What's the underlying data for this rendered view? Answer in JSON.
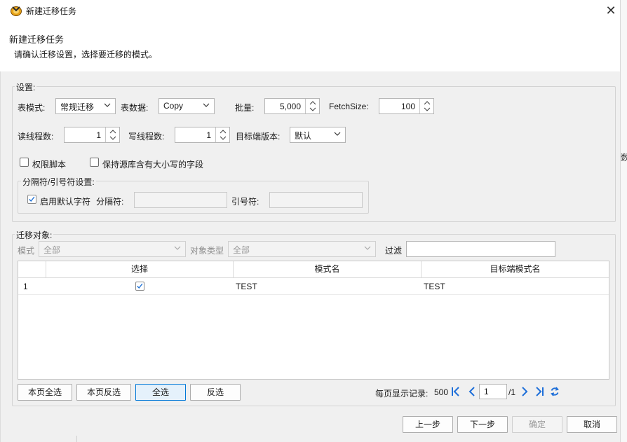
{
  "window": {
    "title": "新建迁移任务",
    "close_glyph": "✕",
    "side_text": "数"
  },
  "header": {
    "title": "新建迁移任务",
    "subtitle": "请确认迁移设置，选择要迁移的模式。"
  },
  "settings": {
    "legend": "设置:",
    "table_mode_label": "表模式:",
    "table_mode_value": "常规迁移",
    "table_data_label": "表数据:",
    "table_data_value": "Copy",
    "batch_label": "批量:",
    "batch_value": "5,000",
    "fetch_label": "FetchSize:",
    "fetch_value": "100",
    "read_threads_label": "读线程数:",
    "read_threads_value": "1",
    "write_threads_label": "写线程数:",
    "write_threads_value": "1",
    "target_version_label": "目标端版本:",
    "target_version_value": "默认",
    "permission_script_label": "权限脚本",
    "permission_script_checked": false,
    "keep_case_label": "保持源库含有大小写的字段",
    "keep_case_checked": false,
    "delimiter": {
      "legend": "分隔符/引号符设置:",
      "use_default_label": "启用默认字符",
      "use_default_checked": true,
      "separator_label": "分隔符:",
      "separator_value": "",
      "quote_label": "引号符:",
      "quote_value": ""
    }
  },
  "objects": {
    "legend": "迁移对象:",
    "schema_label": "模式",
    "schema_value": "全部",
    "object_type_label": "对象类型",
    "object_type_value": "全部",
    "filter_label": "过滤",
    "filter_value": "",
    "columns": [
      "",
      "选择",
      "模式名",
      "目标端模式名"
    ],
    "rows": [
      {
        "index": "1",
        "selected": true,
        "schema": "TEST",
        "target_schema": "TEST"
      }
    ],
    "buttons": {
      "select_page": "本页全选",
      "invert_page": "本页反选",
      "select_all": "全选",
      "invert_all": "反选"
    },
    "pager": {
      "per_page_label": "每页显示记录:",
      "per_page_value": "500",
      "page_value": "1",
      "total_pages": "/1"
    }
  },
  "footer": {
    "prev": "上一步",
    "next": "下一步",
    "ok": "确定",
    "cancel": "取消"
  },
  "colors": {
    "accent": "#0078d7",
    "nav_icon": "#1e6fd9",
    "panel_bg": "#f0f0f0"
  }
}
